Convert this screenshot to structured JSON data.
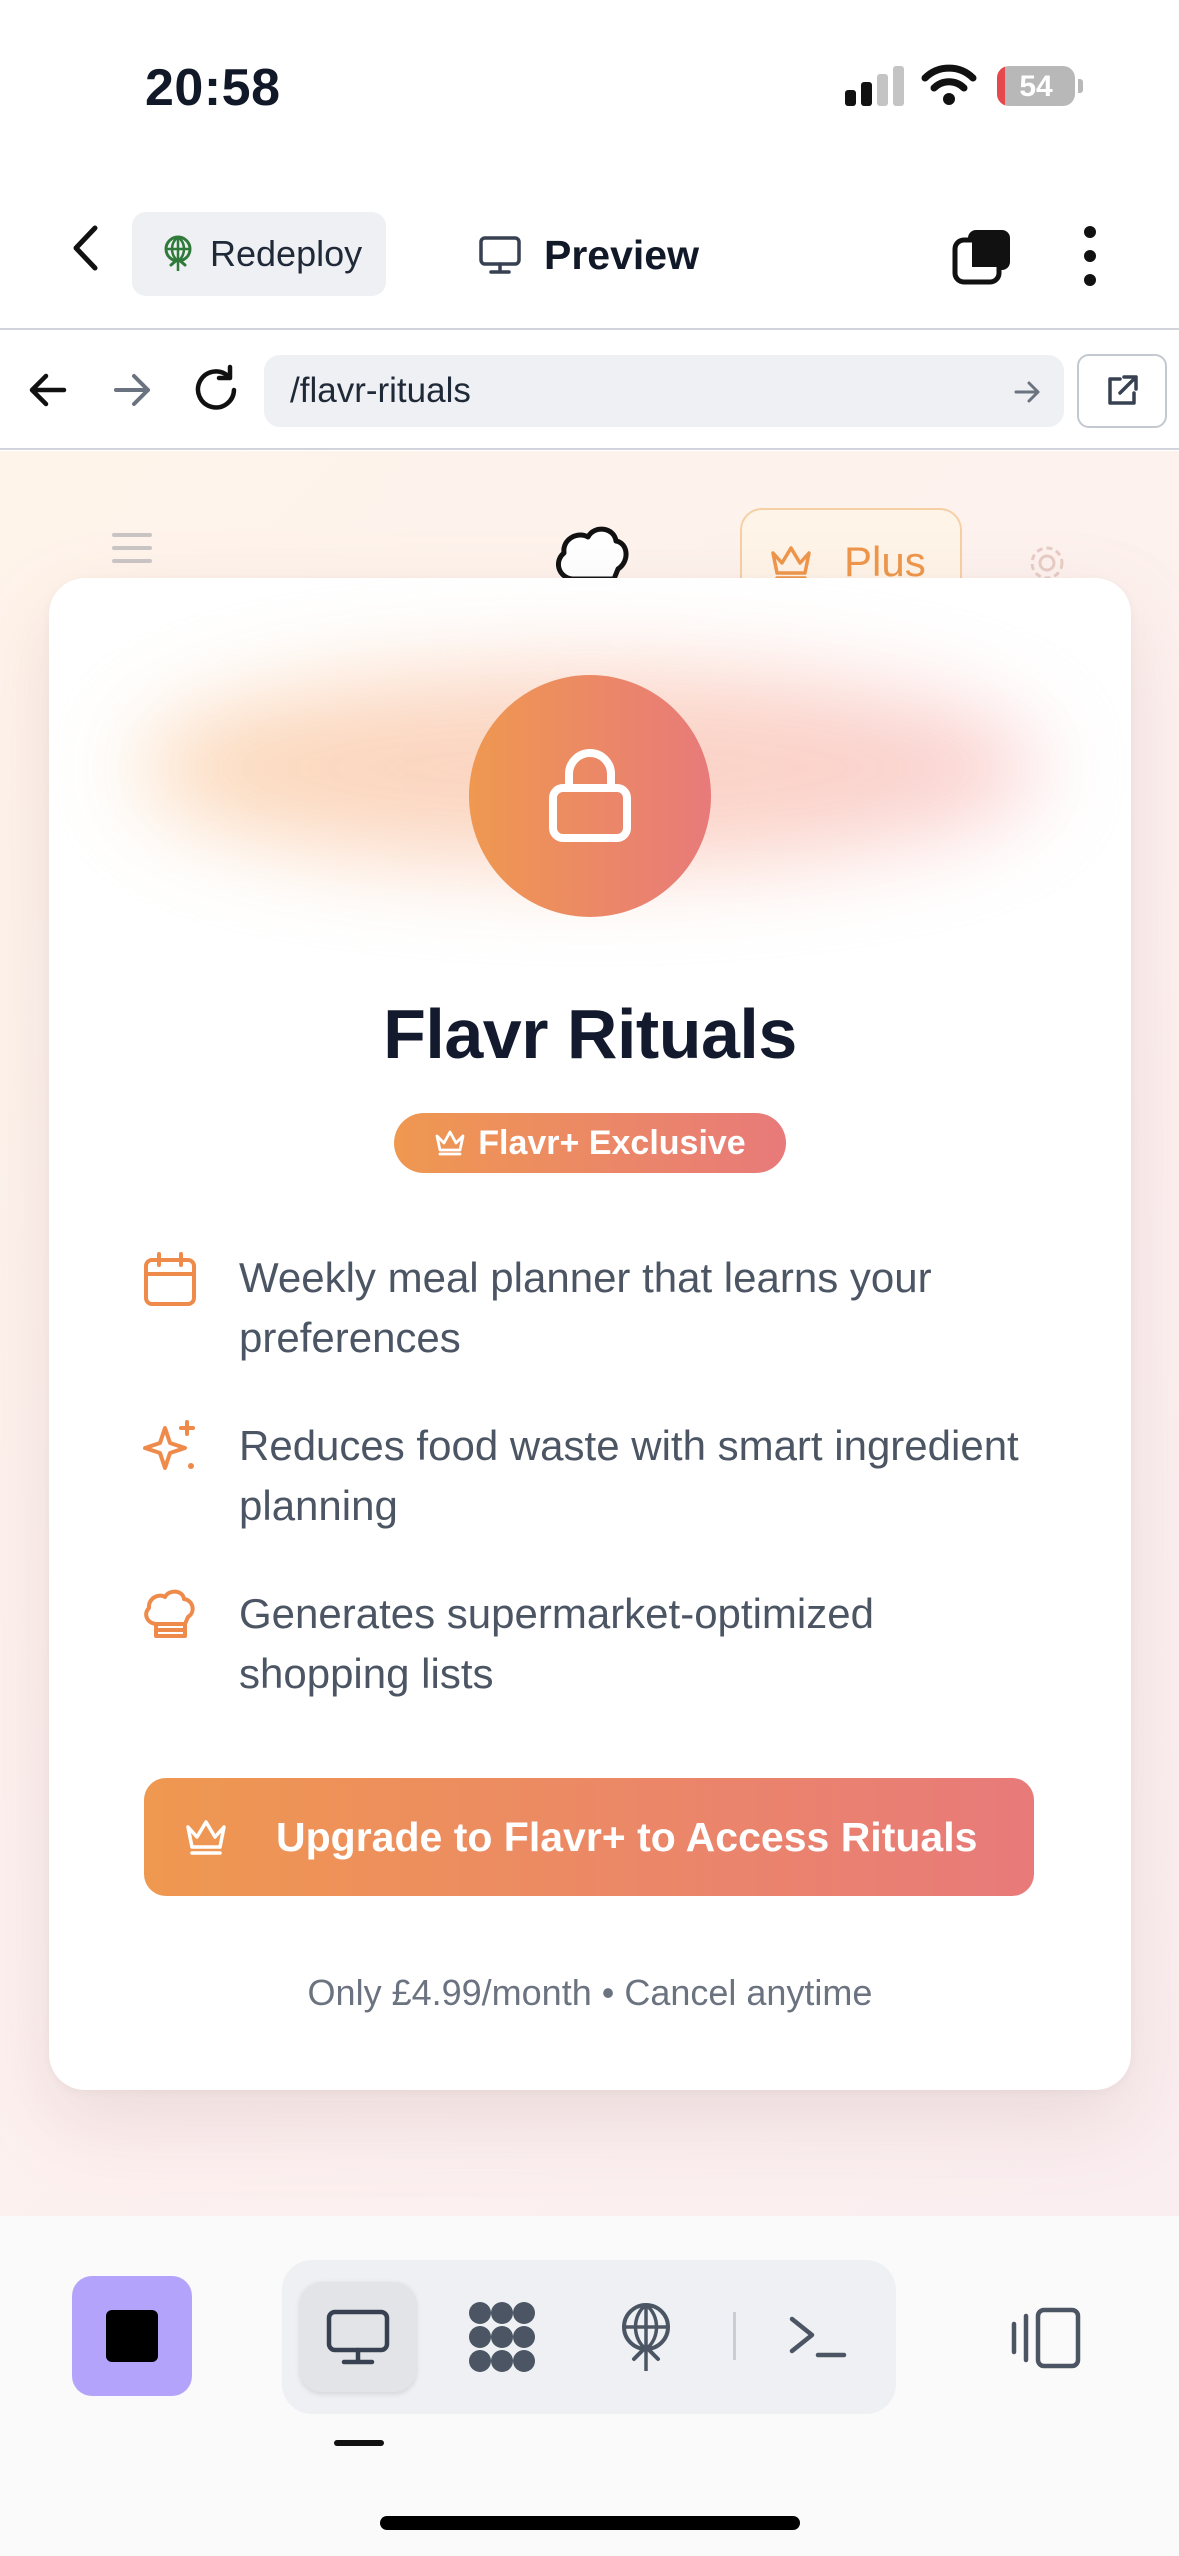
{
  "status_bar": {
    "time": "20:58",
    "battery_level": "54",
    "signal_bars_active": 2,
    "signal_bars_total": 4
  },
  "app_header": {
    "redeploy_label": "Redeploy",
    "preview_label": "Preview",
    "icons": [
      "back-chevron-icon",
      "deploy-icon",
      "monitor-icon",
      "windows-icon",
      "more-vertical-icon"
    ]
  },
  "browser": {
    "url": "/flavr-rituals",
    "icons": [
      "arrow-left-icon",
      "arrow-right-icon",
      "reload-icon",
      "go-arrow-icon",
      "external-link-icon"
    ]
  },
  "site_nav": {
    "plus_label": "Plus",
    "icons": [
      "menu-icon",
      "chef-hat-logo-icon",
      "crown-icon",
      "settings-icon"
    ]
  },
  "paywall": {
    "title": "Flavr Rituals",
    "badge": "Flavr+ Exclusive",
    "features": [
      {
        "icon": "calendar-icon",
        "text": "Weekly meal planner that learns your preferences"
      },
      {
        "icon": "sparkles-icon",
        "text": "Reduces food waste with smart ingredient planning"
      },
      {
        "icon": "chef-hat-icon",
        "text": "Generates supermarket-optimized shopping lists"
      }
    ],
    "cta_label": "Upgrade to Flavr+ to Access Rituals",
    "price_note": "Only £4.99/month • Cancel anytime"
  },
  "toolbar": {
    "active_tab": "preview",
    "tabs": [
      "preview",
      "workflow",
      "deploy",
      "terminal"
    ],
    "icons": [
      "stop-icon",
      "monitor-icon",
      "dots-grid-icon",
      "deploy-icon",
      "terminal-icon",
      "panel-toggle-icon"
    ]
  },
  "colors": {
    "accent_start": "#ef9850",
    "accent_end": "#e87a7a",
    "stop_button": "#b3a3fb",
    "title_text": "#141a2e"
  }
}
